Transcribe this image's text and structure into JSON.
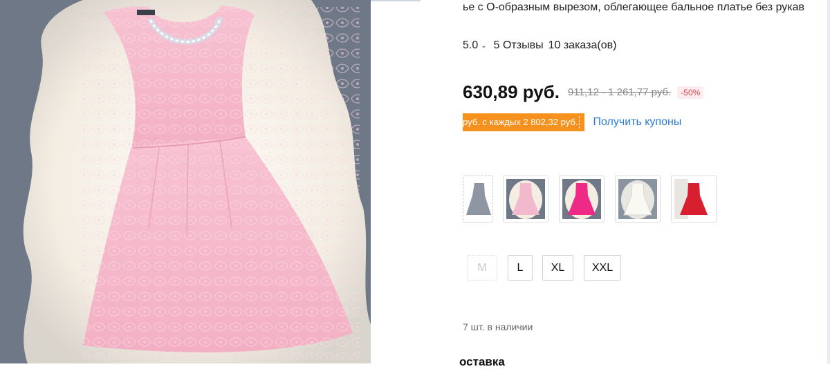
{
  "product": {
    "title": "ье с О-образным вырезом, облегающее бальное платье без рукав",
    "rating": "5.0",
    "reviews": "5 Отзывы",
    "orders": "10 заказа(ов)",
    "price": "630,89 руб.",
    "old_price": "911,12 - 1 261,77 руб.",
    "discount": "-50%",
    "coupon_text": "руб. с каждых 2 802,32 руб.",
    "get_coupons_label": "Получить купоны",
    "stock": "7 шт. в наличии",
    "delivery_label": "оставка"
  },
  "icons": {
    "rating_chevron": "chevron-down-icon"
  },
  "colors": {
    "accent_orange": "#f7911d",
    "link_blue": "#2b7bd4",
    "discount_red": "#e0464e",
    "variants": [
      "#8f96a3",
      "#f2b8cc",
      "#ee2a86",
      "#f4f2ec",
      "#d81f30"
    ]
  },
  "sizes": [
    {
      "label": "M",
      "available": false
    },
    {
      "label": "L",
      "available": true
    },
    {
      "label": "XL",
      "available": true
    },
    {
      "label": "XXL",
      "available": true
    }
  ]
}
